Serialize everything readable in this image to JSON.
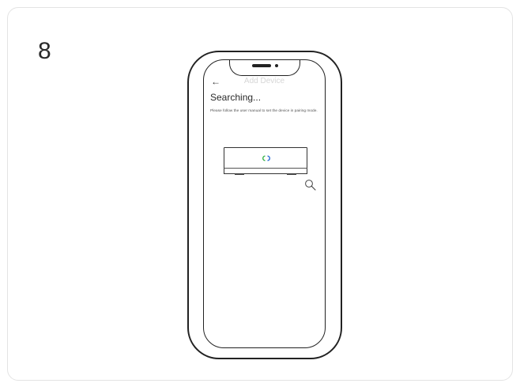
{
  "step": {
    "number": "8"
  },
  "phone_screen": {
    "back_label": "←",
    "title": "Add Device",
    "status": "Searching...",
    "instructions": "Please follow the user manual to set the device in pairing mode."
  },
  "colors": {
    "led_green": "#3cb44b",
    "led_blue": "#2f6fd6",
    "outline": "#222222",
    "title_gray": "#d6d6d6"
  },
  "icons": {
    "back": "back-arrow-icon",
    "search": "magnifier-icon",
    "device": "hub-device-icon"
  }
}
